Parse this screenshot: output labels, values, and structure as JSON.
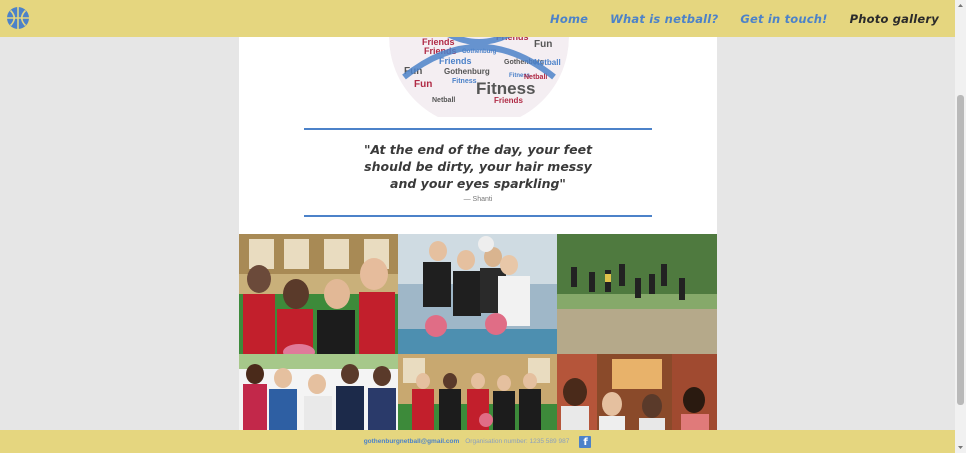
{
  "nav": {
    "logo_icon": "basketball-icon",
    "links": [
      {
        "label": "Home"
      },
      {
        "label": "What is netball?"
      },
      {
        "label": "Get in touch!"
      },
      {
        "label": "Photo gallery"
      }
    ]
  },
  "word_cloud": {
    "words": [
      "Friends",
      "Fun",
      "Gothenburg",
      "Fitness",
      "Netball"
    ]
  },
  "quote": {
    "line1": "\"At the end of the day, your feet",
    "line2": "should be dirty, your hair messy",
    "line3": "and your eyes sparkling\"",
    "author": "— Shanti"
  },
  "footer": {
    "email": "gothenburgnetball@gmail.com",
    "org": "Organisation number: 1235 589 987",
    "social_icon": "facebook-icon",
    "social_glyph": "f"
  },
  "colors": {
    "nav_bg": "#e5d67f",
    "accent_blue": "#4c82c9",
    "cloud_red": "#b02a45",
    "page_bg": "#e6e6e6"
  }
}
